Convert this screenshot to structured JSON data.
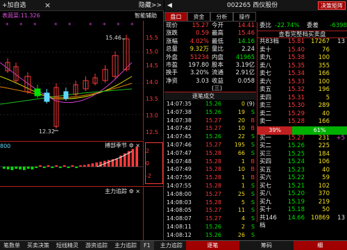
{
  "left": {
    "topbar": {
      "title": "+加自选",
      "close": "×",
      "back": "隐藏>>"
    },
    "sub": {
      "index": "表蔬菜:11.326",
      "assist": "智能辅助"
    },
    "axis": [
      "15.5",
      "15.0",
      "14.5",
      "14.0",
      "13.5",
      "13.0",
      "12.5"
    ],
    "hi_label": "15.46",
    "lo_label": "12.32",
    "macd": {
      "title": "搏部季节",
      "axis": [
        "2",
        "0",
        "-2"
      ]
    },
    "pane3": {
      "title": "主力追踪"
    }
  },
  "right": {
    "stock": "002265 西仪股份",
    "decision": "决策矩阵",
    "tabs": [
      "盘口",
      "资金",
      "分析",
      "操作"
    ],
    "quote": [
      {
        "l": "现价",
        "v": "15.27",
        "l2": "今开",
        "v2": "14.41",
        "c": "r",
        "c2": "r"
      },
      {
        "l": "涨跌",
        "v": "0.59",
        "l2": "最高",
        "v2": "15.46",
        "c": "r",
        "c2": "r"
      },
      {
        "l": "涨幅",
        "v": "4.02%",
        "l2": "最低",
        "v2": "14.16",
        "c": "r",
        "c2": "g"
      },
      {
        "l": "总量",
        "v": "9.32万",
        "l2": "量比",
        "v2": "2.24",
        "c": "y",
        "c2": "w"
      },
      {
        "l": "外盘",
        "v": "51234",
        "l2": "内盘",
        "v2": "41965",
        "c": "r",
        "c2": "g"
      },
      {
        "l": "市盈",
        "v": "197.80",
        "l2": "股本",
        "v2": "3.19亿",
        "c": "w",
        "c2": "w"
      },
      {
        "l": "换手",
        "v": "3.20%",
        "l2": "流通",
        "v2": "2.91亿",
        "c": "w",
        "c2": "w"
      },
      {
        "l": "净资",
        "v": "3.03",
        "l2": "收益(三)",
        "v2": "0.058",
        "c": "w",
        "c2": "w"
      }
    ],
    "ticks_title": "逐笔成交",
    "ticks": [
      {
        "t": "14:07:35",
        "p": "15.26",
        "v": "0",
        "f": "(9)"
      },
      {
        "t": "14:07:38",
        "p": "15.26",
        "v": "19",
        "f": "S"
      },
      {
        "t": "14:07:38",
        "p": "15.27",
        "v": "20",
        "f": "B"
      },
      {
        "t": "14:07:42",
        "p": "15.27",
        "v": "10",
        "f": "B"
      },
      {
        "t": "14:07:45",
        "p": "15.26",
        "v": "22",
        "f": "S"
      },
      {
        "t": "14:07:46",
        "p": "15.27",
        "v": "195",
        "f": "S"
      },
      {
        "t": "14:07:47",
        "p": "15.28",
        "v": "66",
        "f": "S"
      },
      {
        "t": "14:07:48",
        "p": "15.28",
        "v": "1",
        "f": "B"
      },
      {
        "t": "14:07:49",
        "p": "15.28",
        "v": "10",
        "f": "B"
      },
      {
        "t": "14:07:50",
        "p": "15.28",
        "v": "1",
        "f": "B"
      },
      {
        "t": "14:07:55",
        "p": "15.28",
        "v": "1",
        "f": "S"
      },
      {
        "t": "14:08:00",
        "p": "15.27",
        "v": "25",
        "f": "S"
      },
      {
        "t": "14:08:03",
        "p": "15.28",
        "v": "5",
        "f": "S"
      },
      {
        "t": "14:08:05",
        "p": "15.27",
        "v": "11",
        "f": "S"
      },
      {
        "t": "14:08:07",
        "p": "15.27",
        "v": "4",
        "f": "S"
      },
      {
        "t": "14:08:11",
        "p": "15.26",
        "v": "2",
        "f": "S"
      },
      {
        "t": "14:08:12",
        "p": "15.26",
        "v": "26",
        "f": "S"
      }
    ],
    "book": {
      "head": {
        "l": "委比",
        "v": "-22.74%",
        "l2": "委差",
        "v2": "-6398"
      },
      "title": "查看完整档买卖盘",
      "asks": [
        {
          "n": "共83档",
          "p": "15.81",
          "v": "17267",
          "x": "13"
        },
        {
          "n": "卖十",
          "p": "15.40",
          "v": "76",
          "x": ""
        },
        {
          "n": "卖九",
          "p": "15.38",
          "v": "100",
          "x": ""
        },
        {
          "n": "卖八",
          "p": "15.35",
          "v": "355",
          "x": ""
        },
        {
          "n": "卖七",
          "p": "15.34",
          "v": "166",
          "x": ""
        },
        {
          "n": "卖六",
          "p": "15.33",
          "v": "100",
          "x": ""
        },
        {
          "n": "卖五",
          "p": "15.32",
          "v": "196",
          "x": ""
        },
        {
          "n": "卖四",
          "p": "15.31",
          "v": "5",
          "x": ""
        },
        {
          "n": "卖三",
          "p": "15.30",
          "v": "289",
          "x": ""
        },
        {
          "n": "卖二",
          "p": "15.29",
          "v": "40",
          "x": ""
        },
        {
          "n": "卖一",
          "p": "15.28",
          "v": "166",
          "x": ""
        }
      ],
      "ratio": {
        "l": "39%",
        "r": "61%"
      },
      "bids": [
        {
          "n": "买一",
          "p": "15.27",
          "v": "231",
          "x": "+5"
        },
        {
          "n": "买二",
          "p": "15.26",
          "v": "225",
          "x": ""
        },
        {
          "n": "买三",
          "p": "15.25",
          "v": "184",
          "x": ""
        },
        {
          "n": "买四",
          "p": "15.24",
          "v": "106",
          "x": ""
        },
        {
          "n": "买五",
          "p": "15.23",
          "v": "40",
          "x": ""
        },
        {
          "n": "买六",
          "p": "15.22",
          "v": "59",
          "x": ""
        },
        {
          "n": "买七",
          "p": "15.21",
          "v": "102",
          "x": ""
        },
        {
          "n": "买八",
          "p": "15.20",
          "v": "370",
          "x": ""
        },
        {
          "n": "买九",
          "p": "15.19",
          "v": "219",
          "x": ""
        },
        {
          "n": "买十",
          "p": "15.18",
          "v": "50",
          "x": ""
        },
        {
          "n": "共146档",
          "p": "14.66",
          "v": "10869",
          "x": "13"
        }
      ]
    }
  },
  "bottom": {
    "items": [
      "笔数单",
      "买卖决策",
      "短线精灵",
      "游资追踪",
      "主力追踪",
      "F1",
      "主力追踪",
      "逐笔",
      "筹码",
      "细"
    ]
  },
  "colors": {
    "up": "#ff3b3b",
    "down": "#00e000",
    "frame": "#b02020"
  }
}
